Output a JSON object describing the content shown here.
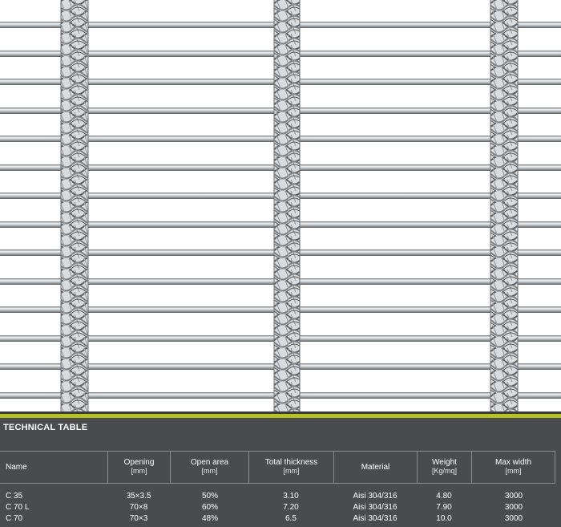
{
  "table": {
    "title": "TECHNICAL TABLE",
    "columns": [
      {
        "label": "Name",
        "unit": ""
      },
      {
        "label": "Opening",
        "unit": "[mm]"
      },
      {
        "label": "Open area",
        "unit": "[mm]"
      },
      {
        "label": "Total thickness",
        "unit": "[mm]"
      },
      {
        "label": "Material",
        "unit": ""
      },
      {
        "label": "Weight",
        "unit": "[Kg/mq]"
      },
      {
        "label": "Max width",
        "unit": "[mm]"
      }
    ],
    "rows": [
      [
        "C 35",
        "35×3.5",
        "50%",
        "3.10",
        "Aisi 304/316",
        "4.80",
        "3000"
      ],
      [
        "C 70 L",
        "70×8",
        "60%",
        "7.20",
        "Aisi 304/316",
        "7.90",
        "3000"
      ],
      [
        "C 70",
        "70×3",
        "48%",
        "6.5",
        "Aisi 304/316",
        "10.0",
        "3000"
      ]
    ]
  },
  "colors": {
    "panel_bg": "#4a4b4d",
    "accent": "#b6c223",
    "rod": "#b8bcbf",
    "cable": "#8e9295"
  }
}
